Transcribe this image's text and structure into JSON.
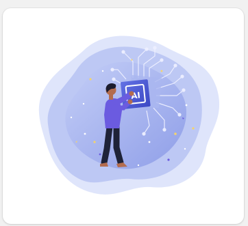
{
  "card": {
    "chip_label": "AI"
  },
  "colors": {
    "page_bg": "#f1f1f1",
    "card_bg": "#ffffff",
    "blob_outer": "#dfe5fb",
    "blob_middle": "#b9c4f3",
    "blob_inner": "#8a9be8",
    "chip": "#4a5bd6",
    "shirt": "#6b5be0",
    "pants": "#1e2238",
    "skin": "#b36c4f",
    "hair": "#1c1c2e",
    "circuit": "#e7eaff"
  },
  "icons": {
    "illustration": "person-placing-ai-chip-icon"
  }
}
